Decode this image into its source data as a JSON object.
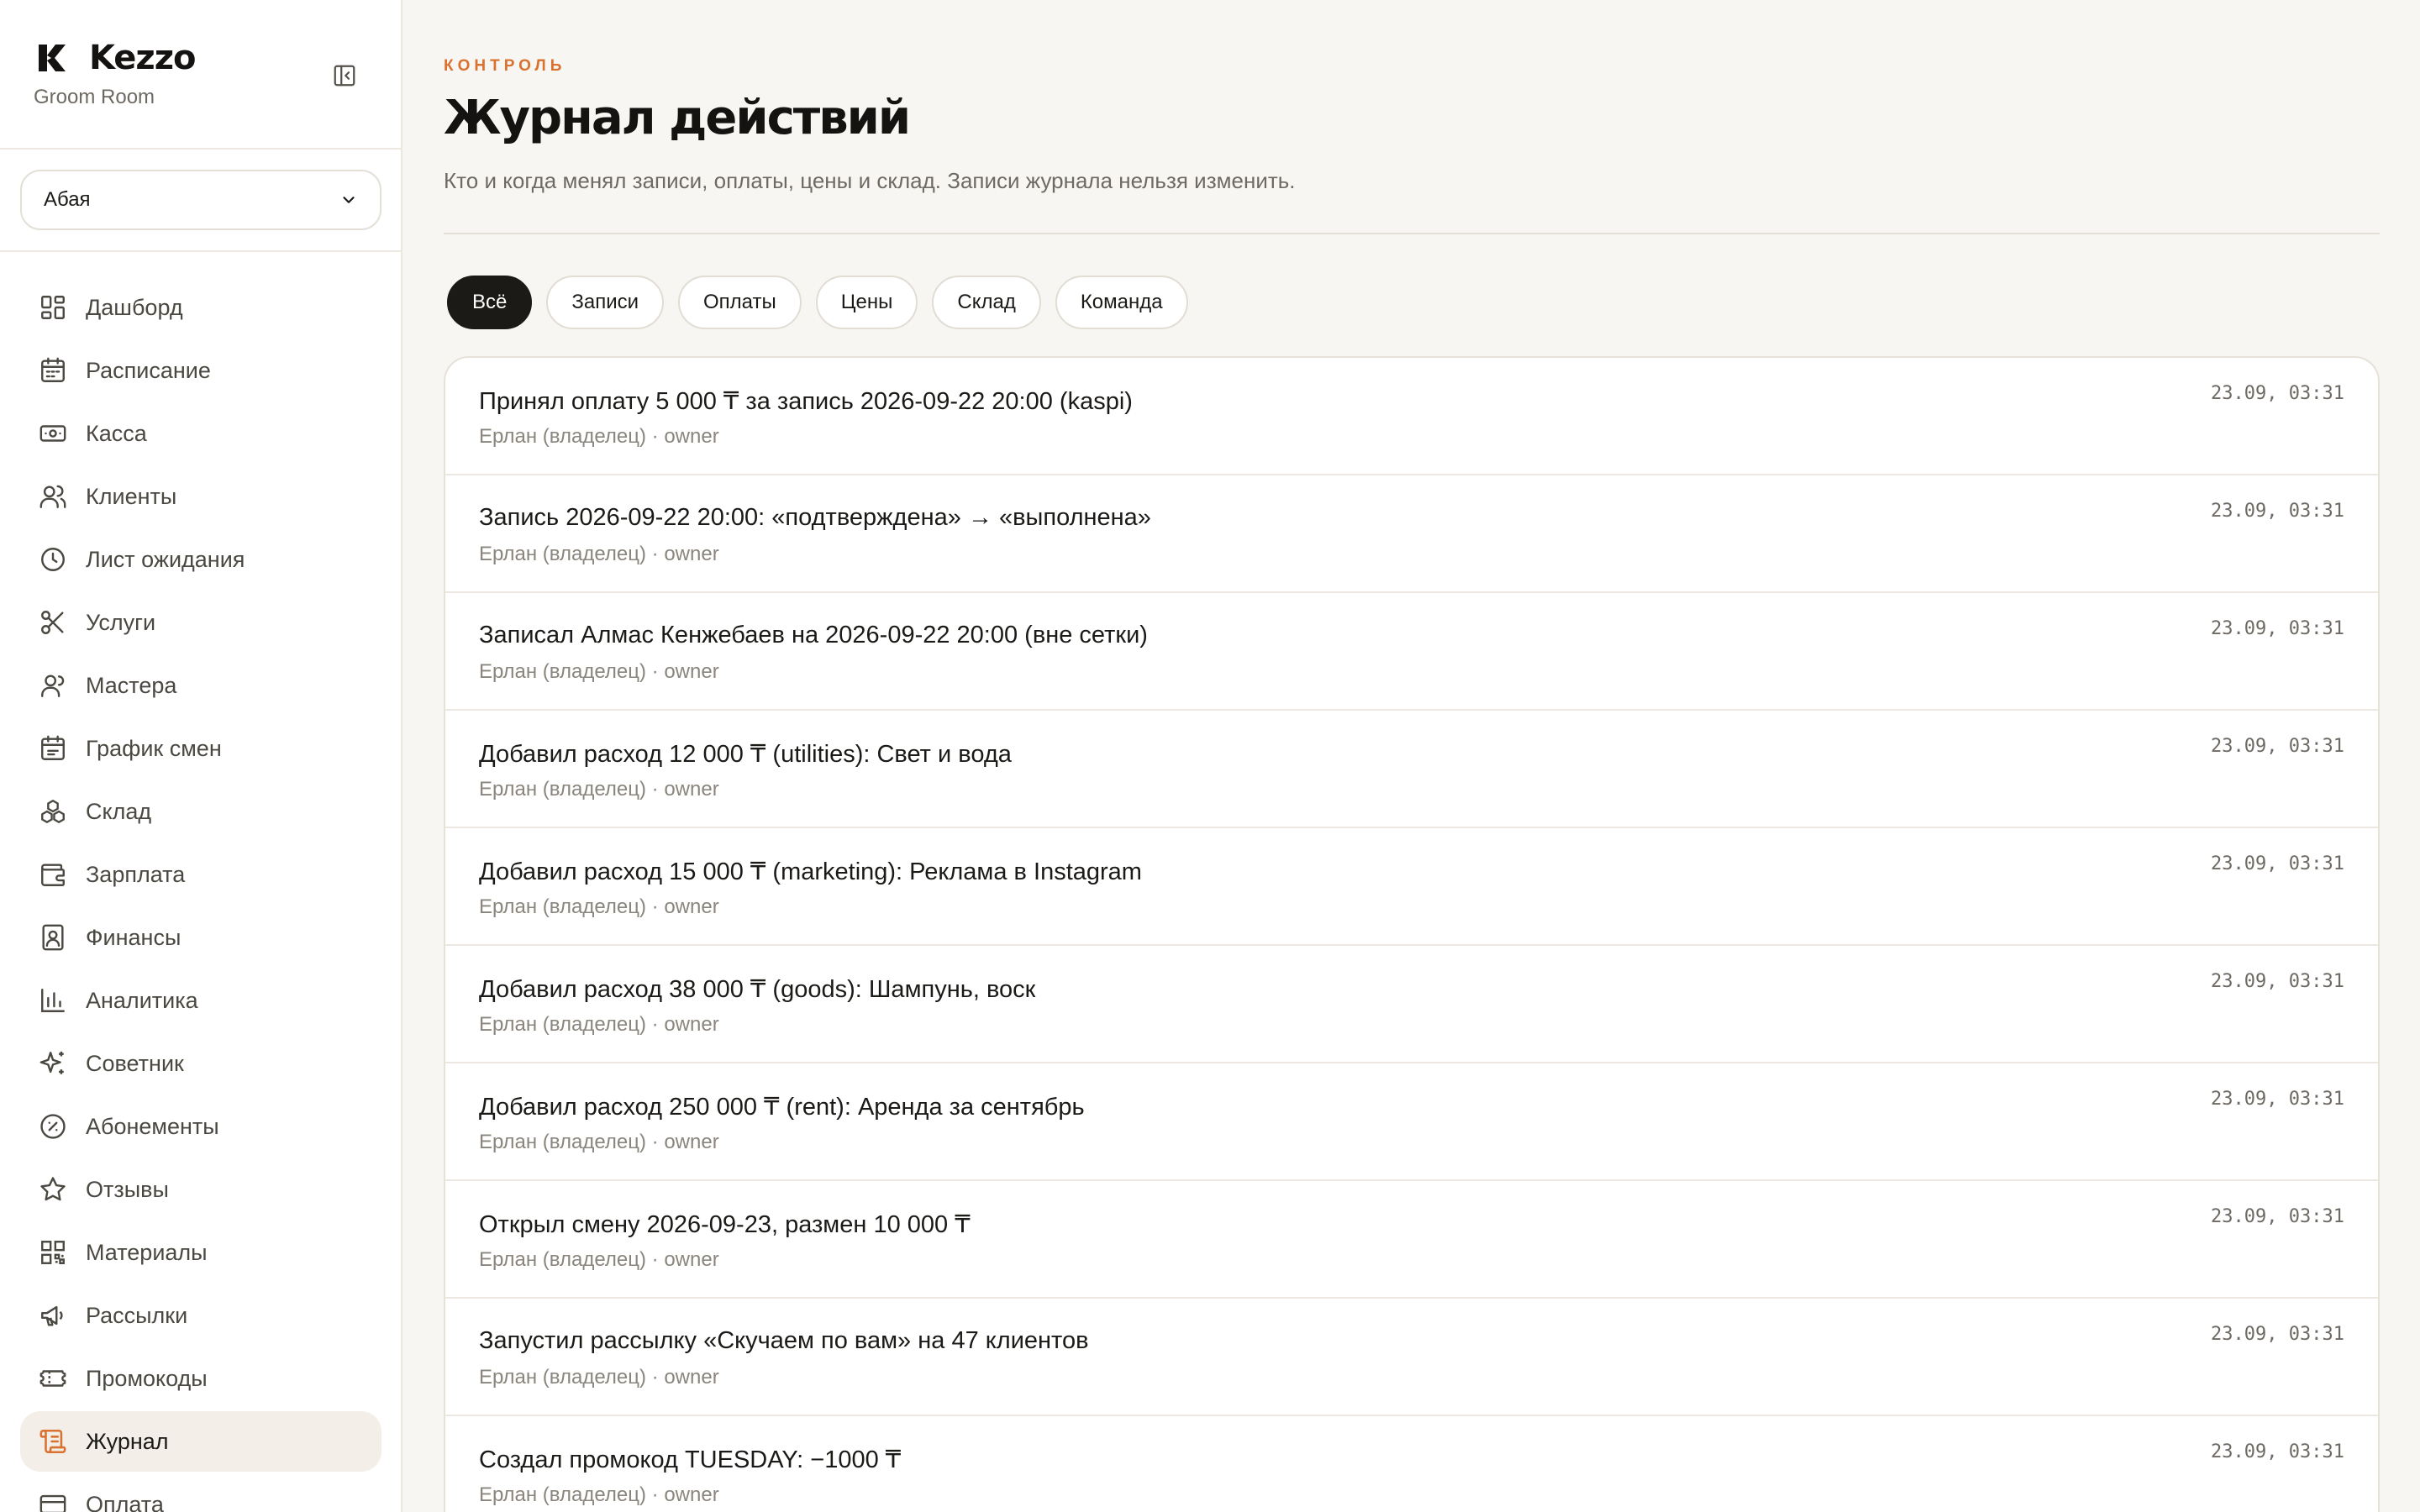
{
  "brand": {
    "name": "Kezzo",
    "subtitle": "Groom Room"
  },
  "branch": {
    "selected": "Абая"
  },
  "nav": {
    "items": [
      {
        "label": "Дашборд",
        "icon": "dashboard-icon"
      },
      {
        "label": "Расписание",
        "icon": "calendar-icon"
      },
      {
        "label": "Касса",
        "icon": "cash-icon"
      },
      {
        "label": "Клиенты",
        "icon": "users-icon"
      },
      {
        "label": "Лист ожидания",
        "icon": "clock-icon"
      },
      {
        "label": "Услуги",
        "icon": "scissors-icon"
      },
      {
        "label": "Мастера",
        "icon": "masters-icon"
      },
      {
        "label": "График смен",
        "icon": "shifts-calendar-icon"
      },
      {
        "label": "Склад",
        "icon": "boxes-icon"
      },
      {
        "label": "Зарплата",
        "icon": "wallet-icon"
      },
      {
        "label": "Финансы",
        "icon": "ledger-icon"
      },
      {
        "label": "Аналитика",
        "icon": "bar-chart-icon"
      },
      {
        "label": "Советник",
        "icon": "sparkles-icon"
      },
      {
        "label": "Абонементы",
        "icon": "badge-percent-icon"
      },
      {
        "label": "Отзывы",
        "icon": "star-icon"
      },
      {
        "label": "Материалы",
        "icon": "qr-code-icon"
      },
      {
        "label": "Рассылки",
        "icon": "megaphone-icon"
      },
      {
        "label": "Промокоды",
        "icon": "ticket-icon"
      },
      {
        "label": "Журнал",
        "icon": "scroll-icon"
      },
      {
        "label": "Оплата",
        "icon": "credit-card-icon"
      }
    ],
    "active_label": "Журнал"
  },
  "header": {
    "eyebrow": "КОНТРОЛЬ",
    "title": "Журнал действий",
    "subtitle": "Кто и когда менял записи, оплаты, цены и склад. Записи журнала нельзя изменить."
  },
  "filters": [
    {
      "label": "Всё",
      "active": true
    },
    {
      "label": "Записи",
      "active": false
    },
    {
      "label": "Оплаты",
      "active": false
    },
    {
      "label": "Цены",
      "active": false
    },
    {
      "label": "Склад",
      "active": false
    },
    {
      "label": "Команда",
      "active": false
    }
  ],
  "log": [
    {
      "title": "Принял оплату 5 000 ₸ за запись 2026-09-22 20:00 (kaspi)",
      "meta": "Ерлан (владелец) · owner",
      "time": "23.09, 03:31"
    },
    {
      "title": "Запись 2026-09-22 20:00: «подтверждена» → «выполнена»",
      "meta": "Ерлан (владелец) · owner",
      "time": "23.09, 03:31"
    },
    {
      "title": "Записал Алмас Кенжебаев на 2026-09-22 20:00 (вне сетки)",
      "meta": "Ерлан (владелец) · owner",
      "time": "23.09, 03:31"
    },
    {
      "title": "Добавил расход 12 000 ₸ (utilities): Свет и вода",
      "meta": "Ерлан (владелец) · owner",
      "time": "23.09, 03:31"
    },
    {
      "title": "Добавил расход 15 000 ₸ (marketing): Реклама в Instagram",
      "meta": "Ерлан (владелец) · owner",
      "time": "23.09, 03:31"
    },
    {
      "title": "Добавил расход 38 000 ₸ (goods): Шампунь, воск",
      "meta": "Ерлан (владелец) · owner",
      "time": "23.09, 03:31"
    },
    {
      "title": "Добавил расход 250 000 ₸ (rent): Аренда за сентябрь",
      "meta": "Ерлан (владелец) · owner",
      "time": "23.09, 03:31"
    },
    {
      "title": "Открыл смену 2026-09-23, размен 10 000 ₸",
      "meta": "Ерлан (владелец) · owner",
      "time": "23.09, 03:31"
    },
    {
      "title": "Запустил рассылку «Скучаем по вам» на 47 клиентов",
      "meta": "Ерлан (владелец) · owner",
      "time": "23.09, 03:31"
    },
    {
      "title": "Создал промокод TUESDAY: −1000 ₸",
      "meta": "Ерлан (владелец) · owner",
      "time": "23.09, 03:31"
    }
  ],
  "colors": {
    "accent": "#d9712f",
    "active_chip": "#1b1a17",
    "active_nav_bg": "#f3efe8",
    "page_bg": "#f8f6f2"
  }
}
